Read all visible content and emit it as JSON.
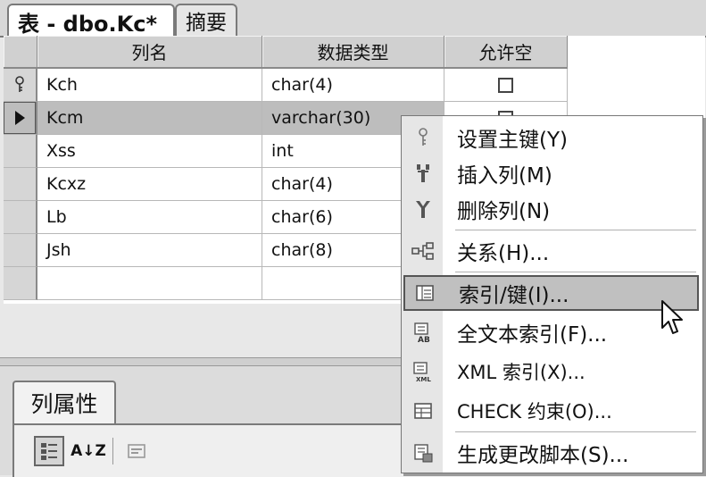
{
  "tabs": {
    "active": "表 - dbo.Kc*",
    "inactive": "摘要"
  },
  "grid": {
    "headers": {
      "name": "列名",
      "type": "数据类型",
      "nullable": "允许空"
    },
    "rows": [
      {
        "name": "Kch",
        "type": "char(4)"
      },
      {
        "name": "Kcm",
        "type": "varchar(30)"
      },
      {
        "name": "Xss",
        "type": "int"
      },
      {
        "name": "Kcxz",
        "type": "char(4)"
      },
      {
        "name": "Lb",
        "type": "char(6)"
      },
      {
        "name": "Jsh",
        "type": "char(8)"
      },
      {
        "name": "",
        "type": ""
      }
    ]
  },
  "properties": {
    "tab": "列属性",
    "sort_glyph": "A↓Z"
  },
  "menu": {
    "items": [
      {
        "label": "设置主键(Y)",
        "icon": "key-icon"
      },
      {
        "label": "插入列(M)",
        "icon": "insert-column-icon"
      },
      {
        "label": "删除列(N)",
        "icon": "delete-column-icon"
      },
      {
        "label": "关系(H)...",
        "icon": "relationships-icon"
      },
      {
        "label": "索引/键(I)...",
        "icon": "indexes-keys-icon"
      },
      {
        "label": "全文本索引(F)...",
        "icon": "fulltext-index-icon"
      },
      {
        "label": "XML 索引(X)...",
        "icon": "xml-index-icon"
      },
      {
        "label": "CHECK 约束(O)...",
        "icon": "check-constraint-icon"
      },
      {
        "label": "生成更改脚本(S)...",
        "icon": "generate-script-icon"
      }
    ]
  }
}
